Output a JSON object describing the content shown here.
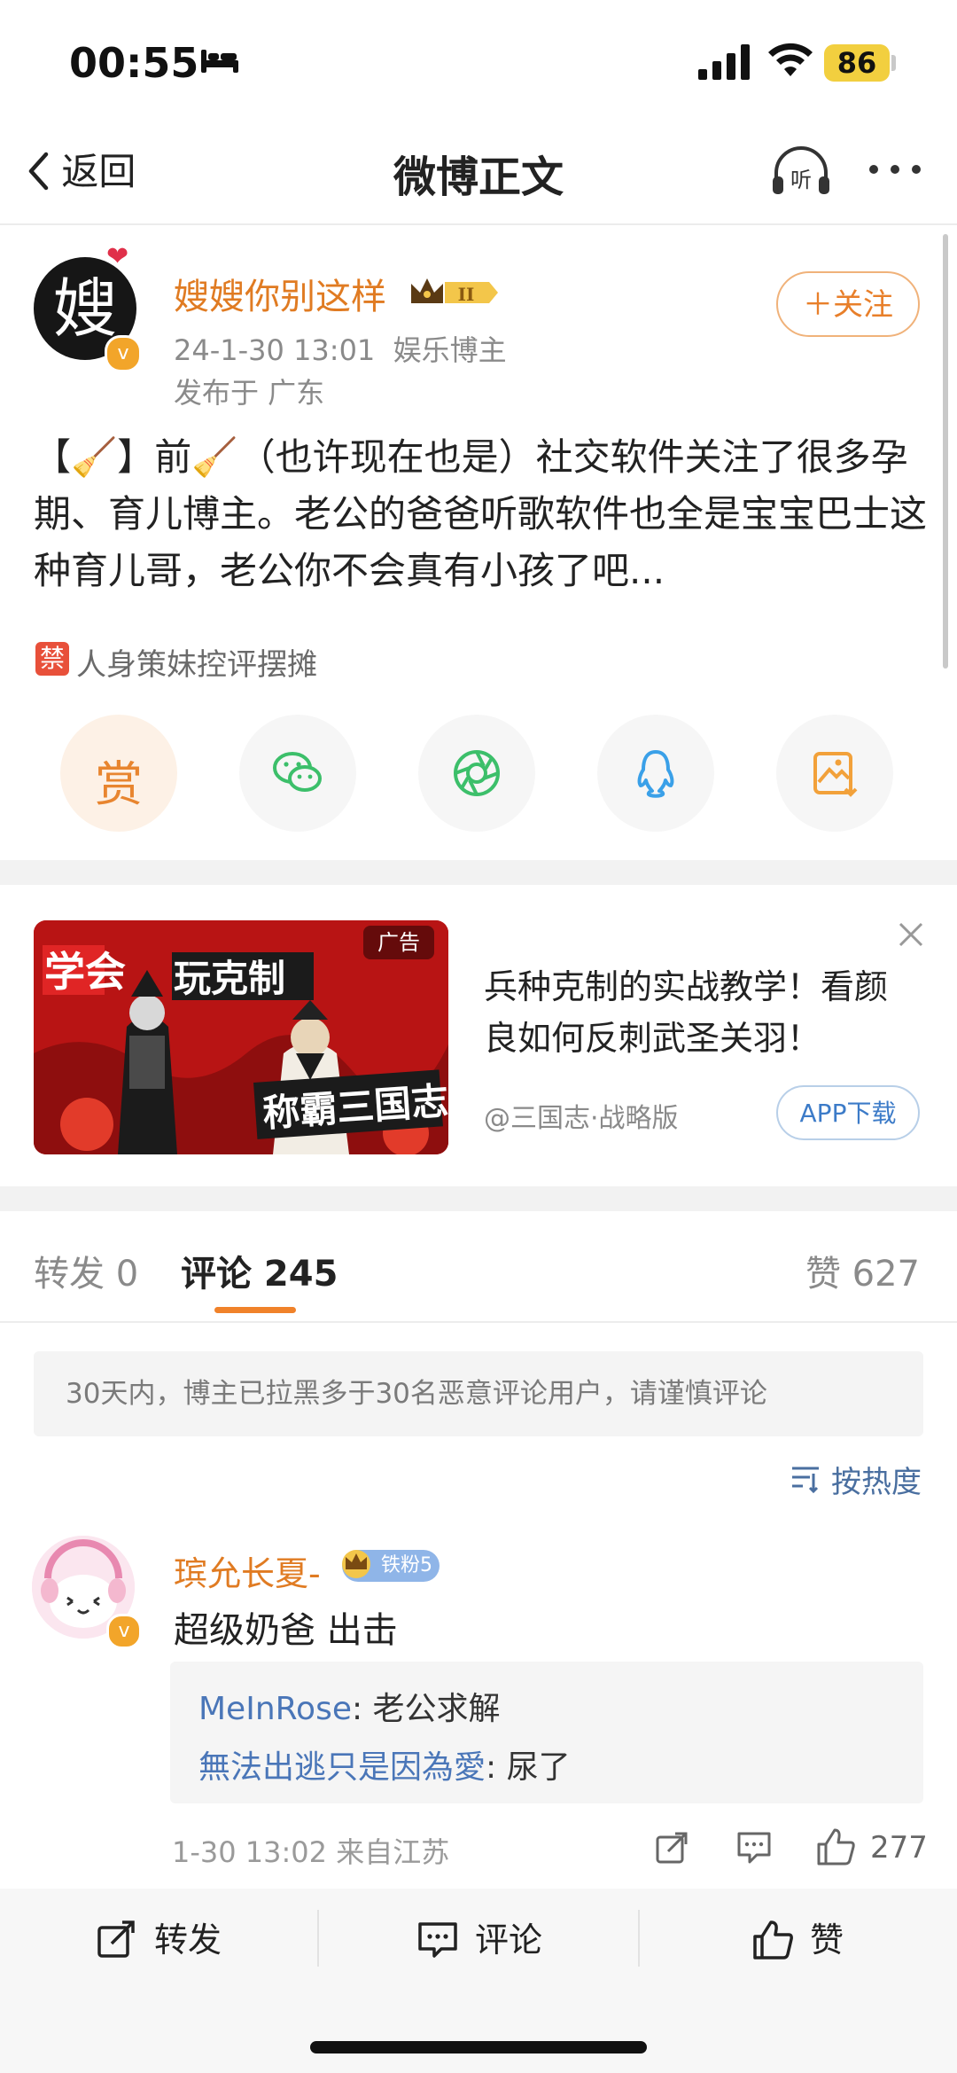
{
  "status": {
    "time": "00:55",
    "battery": "86"
  },
  "nav": {
    "back": "返回",
    "title": "微博正文"
  },
  "post": {
    "author": "嫂嫂你别这样",
    "avatar_char": "嫂",
    "date": "24-1-30 13:01",
    "role": "娱乐博主",
    "location": "发布于 广东",
    "follow": "＋关注",
    "text": "【🧹】前🧹（也许现在也是）社交软件关注了很多孕期、育儿博主。老公的爸爸听歌软件也全是宝宝巴士这种育儿哥，老公你不会真有小孩了吧...",
    "tag_icon": "禁",
    "tag": "人身策妹控评摆摊",
    "reward": "赏"
  },
  "ad": {
    "label": "广告",
    "title": "兵种克制的实战教学！看颜良如何反刺武圣关羽！",
    "source": "@三国志·战略版",
    "button": "APP下载",
    "img_text1": "学会",
    "img_text2": "玩克制",
    "img_text3": "称霸三国志"
  },
  "tabs": {
    "repost": "转发 0",
    "comment": "评论 245",
    "like": "赞 627"
  },
  "notice": "30天内，博主已拉黑多于30名恶意评论用户，请谨慎评论",
  "sort": "按热度",
  "comment": {
    "name": "瑸允长夏-",
    "fan_badge": "铁粉5",
    "text": "超级奶爸 出击",
    "replies": [
      {
        "user": "MeInRose",
        "text": "老公求解"
      },
      {
        "user": "無法出逃只是因為愛",
        "text": "尿了"
      }
    ],
    "meta": "1-30 13:02 来自江苏",
    "likes": "277"
  },
  "bottom": {
    "repost": "转发",
    "comment": "评论",
    "like": "赞"
  },
  "colors": {
    "accent": "#e07b22",
    "link": "#4a76b8",
    "ad_red": "#c41d1d"
  }
}
